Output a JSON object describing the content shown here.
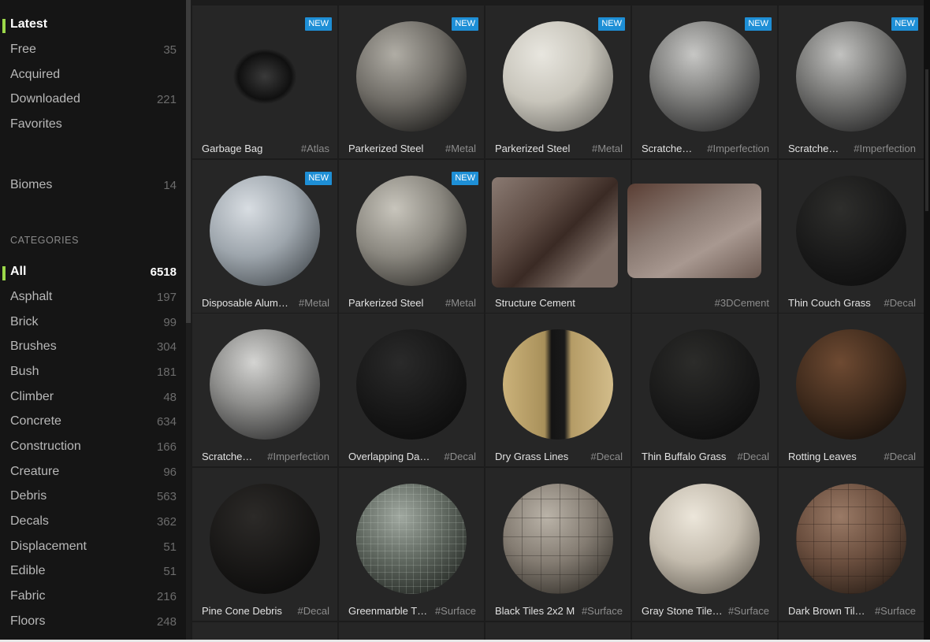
{
  "sidebar": {
    "filters": [
      {
        "label": "Latest",
        "count": "",
        "active": true
      },
      {
        "label": "Free",
        "count": "35",
        "active": false
      },
      {
        "label": "Acquired",
        "count": "",
        "active": false
      },
      {
        "label": "Downloaded",
        "count": "221",
        "active": false
      },
      {
        "label": "Favorites",
        "count": "",
        "active": false
      },
      {
        "label": "Biomes",
        "count": "14",
        "active": false
      }
    ],
    "categories_heading": "CATEGORIES",
    "categories": [
      {
        "label": "All",
        "count": "6518",
        "active": true
      },
      {
        "label": "Asphalt",
        "count": "197",
        "active": false
      },
      {
        "label": "Brick",
        "count": "99",
        "active": false
      },
      {
        "label": "Brushes",
        "count": "304",
        "active": false
      },
      {
        "label": "Bush",
        "count": "181",
        "active": false
      },
      {
        "label": "Climber",
        "count": "48",
        "active": false
      },
      {
        "label": "Concrete",
        "count": "634",
        "active": false
      },
      {
        "label": "Construction",
        "count": "166",
        "active": false
      },
      {
        "label": "Creature",
        "count": "96",
        "active": false
      },
      {
        "label": "Debris",
        "count": "563",
        "active": false
      },
      {
        "label": "Decals",
        "count": "362",
        "active": false
      },
      {
        "label": "Displacement",
        "count": "51",
        "active": false
      },
      {
        "label": "Edible",
        "count": "51",
        "active": false
      },
      {
        "label": "Fabric",
        "count": "216",
        "active": false
      },
      {
        "label": "Floors",
        "count": "248",
        "active": false
      }
    ]
  },
  "grid": {
    "badge_label": "NEW",
    "assets": [
      {
        "name": "Garbage Bag",
        "tag": "#Atlas",
        "is_new": true,
        "thumb": "garbage"
      },
      {
        "name": "Parkerized Steel",
        "tag": "#Metal",
        "is_new": true,
        "thumb": "steel"
      },
      {
        "name": "Parkerized Steel",
        "tag": "#Metal",
        "is_new": true,
        "thumb": "light"
      },
      {
        "name": "Scratche…",
        "tag": "#Imperfection",
        "is_new": true,
        "thumb": "scratch"
      },
      {
        "name": "Scratche…",
        "tag": "#Imperfection",
        "is_new": true,
        "thumb": "scratch"
      },
      {
        "name": "Disposable Alum…",
        "tag": "#Metal",
        "is_new": true,
        "thumb": "alum"
      },
      {
        "name": "Parkerized Steel",
        "tag": "#Metal",
        "is_new": true,
        "thumb": "steel"
      },
      {
        "name": "Structure Cement",
        "tag": "",
        "is_new": false,
        "thumb": "cement"
      },
      {
        "name": "",
        "tag": "#3DCement",
        "is_new": false,
        "thumb": "cement"
      },
      {
        "name": "Thin Couch Grass",
        "tag": "#Decal",
        "is_new": false,
        "thumb": "couch"
      },
      {
        "name": "Scratche…",
        "tag": "#Imperfection",
        "is_new": false,
        "thumb": "scratch2"
      },
      {
        "name": "Overlapping Da…",
        "tag": "#Decal",
        "is_new": false,
        "thumb": "overlap"
      },
      {
        "name": "Dry Grass Lines",
        "tag": "#Decal",
        "is_new": false,
        "thumb": "drygrass"
      },
      {
        "name": "Thin Buffalo Grass",
        "tag": "#Decal",
        "is_new": false,
        "thumb": "buffalo"
      },
      {
        "name": "Rotting Leaves",
        "tag": "#Decal",
        "is_new": false,
        "thumb": "leaves"
      },
      {
        "name": "Pine Cone Debris",
        "tag": "#Decal",
        "is_new": false,
        "thumb": "pine"
      },
      {
        "name": "Greenmarble T…",
        "tag": "#Surface",
        "is_new": false,
        "thumb": "greenmarble"
      },
      {
        "name": "Black Tiles 2x2 M",
        "tag": "#Surface",
        "is_new": false,
        "thumb": "blacktiles"
      },
      {
        "name": "Gray Stone Tile…",
        "tag": "#Surface",
        "is_new": false,
        "thumb": "graystone"
      },
      {
        "name": "Dark Brown Til…",
        "tag": "#Surface",
        "is_new": false,
        "thumb": "darkbrown"
      }
    ]
  }
}
